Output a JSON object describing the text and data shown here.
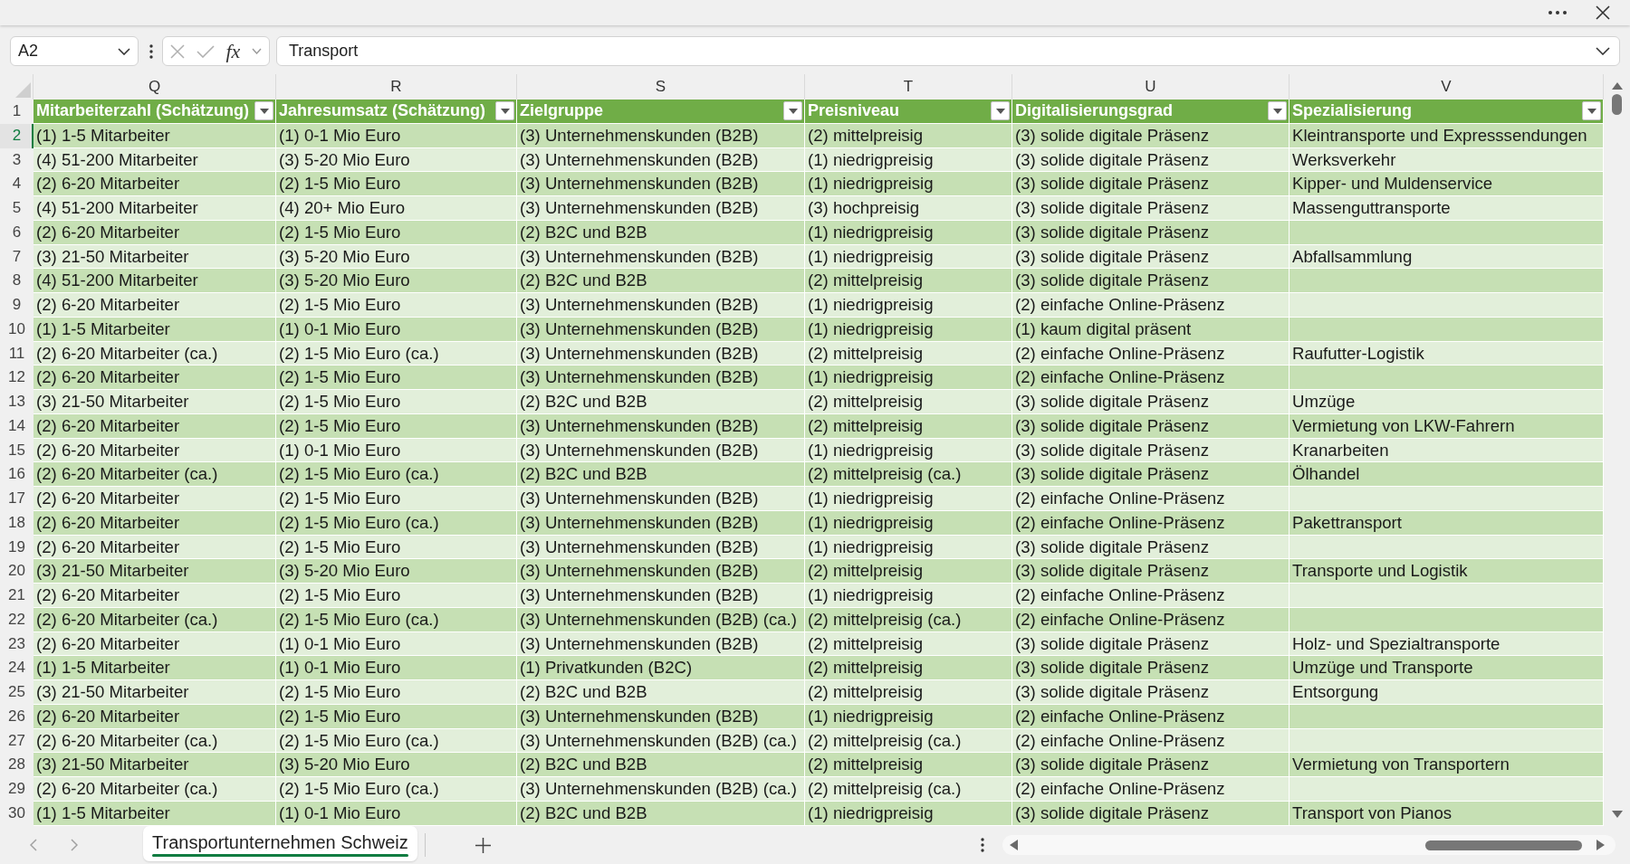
{
  "formula_bar": {
    "name_box": "A2",
    "function_label": "fx",
    "formula": "Transport"
  },
  "columns": [
    {
      "letter": "Q",
      "header": "Mitarbeiterzahl (Schätzung)"
    },
    {
      "letter": "R",
      "header": "Jahresumsatz (Schätzung)"
    },
    {
      "letter": "S",
      "header": "Zielgruppe"
    },
    {
      "letter": "T",
      "header": "Preisniveau"
    },
    {
      "letter": "U",
      "header": "Digitalisierungsgrad"
    },
    {
      "letter": "V",
      "header": "Spezialisierung"
    }
  ],
  "header_row_number": "1",
  "rows": [
    {
      "number": "2",
      "selected": true,
      "mitarbeiterzahl": "(1) 1-5 Mitarbeiter",
      "jahresumsatz": "(1) 0-1 Mio Euro",
      "zielgruppe": "(3) Unternehmenskunden (B2B)",
      "preisniveau": "(2) mittelpreisig",
      "digitalisierungsgrad": "(3) solide digitale Präsenz",
      "spezialisierung": "Kleintransporte und Expresssendungen"
    },
    {
      "number": "3",
      "selected": false,
      "mitarbeiterzahl": "(4) 51-200 Mitarbeiter",
      "jahresumsatz": "(3) 5-20 Mio Euro",
      "zielgruppe": "(3) Unternehmenskunden (B2B)",
      "preisniveau": "(1) niedrigpreisig",
      "digitalisierungsgrad": "(3) solide digitale Präsenz",
      "spezialisierung": "Werksverkehr"
    },
    {
      "number": "4",
      "selected": false,
      "mitarbeiterzahl": "(2) 6-20 Mitarbeiter",
      "jahresumsatz": "(2) 1-5 Mio Euro",
      "zielgruppe": "(3) Unternehmenskunden (B2B)",
      "preisniveau": "(1) niedrigpreisig",
      "digitalisierungsgrad": "(3) solide digitale Präsenz",
      "spezialisierung": "Kipper- und Muldenservice"
    },
    {
      "number": "5",
      "selected": false,
      "mitarbeiterzahl": "(4) 51-200 Mitarbeiter",
      "jahresumsatz": "(4) 20+ Mio Euro",
      "zielgruppe": "(3) Unternehmenskunden (B2B)",
      "preisniveau": "(3) hochpreisig",
      "digitalisierungsgrad": "(3) solide digitale Präsenz",
      "spezialisierung": "Massenguttransporte"
    },
    {
      "number": "6",
      "selected": false,
      "mitarbeiterzahl": "(2) 6-20 Mitarbeiter",
      "jahresumsatz": "(2) 1-5 Mio Euro",
      "zielgruppe": "(2) B2C und B2B",
      "preisniveau": "(1) niedrigpreisig",
      "digitalisierungsgrad": "(3) solide digitale Präsenz"
    },
    {
      "number": "7",
      "selected": false,
      "mitarbeiterzahl": "(3) 21-50 Mitarbeiter",
      "jahresumsatz": "(3) 5-20 Mio Euro",
      "zielgruppe": "(3) Unternehmenskunden (B2B)",
      "preisniveau": "(1) niedrigpreisig",
      "digitalisierungsgrad": "(3) solide digitale Präsenz",
      "spezialisierung": "Abfallsammlung"
    },
    {
      "number": "8",
      "selected": false,
      "mitarbeiterzahl": "(4) 51-200 Mitarbeiter",
      "jahresumsatz": "(3) 5-20 Mio Euro",
      "zielgruppe": "(2) B2C und B2B",
      "preisniveau": "(2) mittelpreisig",
      "digitalisierungsgrad": "(3) solide digitale Präsenz"
    },
    {
      "number": "9",
      "selected": false,
      "mitarbeiterzahl": "(2) 6-20 Mitarbeiter",
      "jahresumsatz": "(2) 1-5 Mio Euro",
      "zielgruppe": "(3) Unternehmenskunden (B2B)",
      "preisniveau": "(1) niedrigpreisig",
      "digitalisierungsgrad": "(2) einfache Online-Präsenz"
    },
    {
      "number": "10",
      "selected": false,
      "mitarbeiterzahl": "(1) 1-5 Mitarbeiter",
      "jahresumsatz": "(1) 0-1 Mio Euro",
      "zielgruppe": "(3) Unternehmenskunden (B2B)",
      "preisniveau": "(1) niedrigpreisig",
      "digitalisierungsgrad": "(1) kaum digital präsent"
    },
    {
      "number": "11",
      "selected": false,
      "mitarbeiterzahl": "(2) 6-20 Mitarbeiter (ca.)",
      "jahresumsatz": "(2) 1-5 Mio Euro (ca.)",
      "zielgruppe": "(3) Unternehmenskunden (B2B)",
      "preisniveau": "(2) mittelpreisig",
      "digitalisierungsgrad": "(2) einfache Online-Präsenz",
      "spezialisierung": "Raufutter-Logistik"
    },
    {
      "number": "12",
      "selected": false,
      "mitarbeiterzahl": "(2) 6-20 Mitarbeiter",
      "jahresumsatz": "(2) 1-5 Mio Euro",
      "zielgruppe": "(3) Unternehmenskunden (B2B)",
      "preisniveau": "(1) niedrigpreisig",
      "digitalisierungsgrad": "(2) einfache Online-Präsenz"
    },
    {
      "number": "13",
      "selected": false,
      "mitarbeiterzahl": "(3) 21-50 Mitarbeiter",
      "jahresumsatz": "(2) 1-5 Mio Euro",
      "zielgruppe": "(2) B2C und B2B",
      "preisniveau": "(2) mittelpreisig",
      "digitalisierungsgrad": "(3) solide digitale Präsenz",
      "spezialisierung": "Umzüge"
    },
    {
      "number": "14",
      "selected": false,
      "mitarbeiterzahl": "(2) 6-20 Mitarbeiter",
      "jahresumsatz": "(2) 1-5 Mio Euro",
      "zielgruppe": "(3) Unternehmenskunden (B2B)",
      "preisniveau": "(2) mittelpreisig",
      "digitalisierungsgrad": "(3) solide digitale Präsenz",
      "spezialisierung": "Vermietung von LKW-Fahrern"
    },
    {
      "number": "15",
      "selected": false,
      "mitarbeiterzahl": "(2) 6-20 Mitarbeiter",
      "jahresumsatz": "(1) 0-1 Mio Euro",
      "zielgruppe": "(3) Unternehmenskunden (B2B)",
      "preisniveau": "(1) niedrigpreisig",
      "digitalisierungsgrad": "(3) solide digitale Präsenz",
      "spezialisierung": "Kranarbeiten"
    },
    {
      "number": "16",
      "selected": false,
      "mitarbeiterzahl": "(2) 6-20 Mitarbeiter (ca.)",
      "jahresumsatz": "(2) 1-5 Mio Euro (ca.)",
      "zielgruppe": "(2) B2C und B2B",
      "preisniveau": "(2) mittelpreisig (ca.)",
      "digitalisierungsgrad": "(3) solide digitale Präsenz",
      "spezialisierung": "Ölhandel"
    },
    {
      "number": "17",
      "selected": false,
      "mitarbeiterzahl": "(2) 6-20 Mitarbeiter",
      "jahresumsatz": "(2) 1-5 Mio Euro",
      "zielgruppe": "(3) Unternehmenskunden (B2B)",
      "preisniveau": "(1) niedrigpreisig",
      "digitalisierungsgrad": "(2) einfache Online-Präsenz"
    },
    {
      "number": "18",
      "selected": false,
      "mitarbeiterzahl": "(2) 6-20 Mitarbeiter",
      "jahresumsatz": "(2) 1-5 Mio Euro (ca.)",
      "zielgruppe": "(3) Unternehmenskunden (B2B)",
      "preisniveau": "(1) niedrigpreisig",
      "digitalisierungsgrad": "(2) einfache Online-Präsenz",
      "spezialisierung": "Pakettransport"
    },
    {
      "number": "19",
      "selected": false,
      "mitarbeiterzahl": "(2) 6-20 Mitarbeiter",
      "jahresumsatz": "(2) 1-5 Mio Euro",
      "zielgruppe": "(3) Unternehmenskunden (B2B)",
      "preisniveau": "(1) niedrigpreisig",
      "digitalisierungsgrad": "(3) solide digitale Präsenz"
    },
    {
      "number": "20",
      "selected": false,
      "mitarbeiterzahl": "(3) 21-50 Mitarbeiter",
      "jahresumsatz": "(3) 5-20 Mio Euro",
      "zielgruppe": "(3) Unternehmenskunden (B2B)",
      "preisniveau": "(2) mittelpreisig",
      "digitalisierungsgrad": "(3) solide digitale Präsenz",
      "spezialisierung": "Transporte und Logistik"
    },
    {
      "number": "21",
      "selected": false,
      "mitarbeiterzahl": "(2) 6-20 Mitarbeiter",
      "jahresumsatz": "(2) 1-5 Mio Euro",
      "zielgruppe": "(3) Unternehmenskunden (B2B)",
      "preisniveau": "(1) niedrigpreisig",
      "digitalisierungsgrad": "(2) einfache Online-Präsenz"
    },
    {
      "number": "22",
      "selected": false,
      "mitarbeiterzahl": "(2) 6-20 Mitarbeiter (ca.)",
      "jahresumsatz": "(2) 1-5 Mio Euro (ca.)",
      "zielgruppe": "(3) Unternehmenskunden (B2B) (ca.)",
      "preisniveau": "(2) mittelpreisig (ca.)",
      "digitalisierungsgrad": "(2) einfache Online-Präsenz"
    },
    {
      "number": "23",
      "selected": false,
      "mitarbeiterzahl": "(2) 6-20 Mitarbeiter",
      "jahresumsatz": "(1) 0-1 Mio Euro",
      "zielgruppe": "(3) Unternehmenskunden (B2B)",
      "preisniveau": "(2) mittelpreisig",
      "digitalisierungsgrad": "(3) solide digitale Präsenz",
      "spezialisierung": "Holz- und Spezialtransporte"
    },
    {
      "number": "24",
      "selected": false,
      "mitarbeiterzahl": "(1) 1-5 Mitarbeiter",
      "jahresumsatz": "(1) 0-1 Mio Euro",
      "zielgruppe": "(1) Privatkunden (B2C)",
      "preisniveau": "(2) mittelpreisig",
      "digitalisierungsgrad": "(3) solide digitale Präsenz",
      "spezialisierung": "Umzüge und Transporte"
    },
    {
      "number": "25",
      "selected": false,
      "mitarbeiterzahl": "(3) 21-50 Mitarbeiter",
      "jahresumsatz": "(2) 1-5 Mio Euro",
      "zielgruppe": "(2) B2C und B2B",
      "preisniveau": "(2) mittelpreisig",
      "digitalisierungsgrad": "(3) solide digitale Präsenz",
      "spezialisierung": "Entsorgung"
    },
    {
      "number": "26",
      "selected": false,
      "mitarbeiterzahl": "(2) 6-20 Mitarbeiter",
      "jahresumsatz": "(2) 1-5 Mio Euro",
      "zielgruppe": "(3) Unternehmenskunden (B2B)",
      "preisniveau": "(1) niedrigpreisig",
      "digitalisierungsgrad": "(2) einfache Online-Präsenz"
    },
    {
      "number": "27",
      "selected": false,
      "mitarbeiterzahl": "(2) 6-20 Mitarbeiter (ca.)",
      "jahresumsatz": "(2) 1-5 Mio Euro (ca.)",
      "zielgruppe": "(3) Unternehmenskunden (B2B) (ca.)",
      "preisniveau": "(2) mittelpreisig (ca.)",
      "digitalisierungsgrad": "(2) einfache Online-Präsenz"
    },
    {
      "number": "28",
      "selected": false,
      "mitarbeiterzahl": "(3) 21-50 Mitarbeiter",
      "jahresumsatz": "(3) 5-20 Mio Euro",
      "zielgruppe": "(2) B2C und B2B",
      "preisniveau": "(2) mittelpreisig",
      "digitalisierungsgrad": "(3) solide digitale Präsenz",
      "spezialisierung": "Vermietung von Transportern"
    },
    {
      "number": "29",
      "selected": false,
      "mitarbeiterzahl": "(2) 6-20 Mitarbeiter (ca.)",
      "jahresumsatz": "(2) 1-5 Mio Euro (ca.)",
      "zielgruppe": "(3) Unternehmenskunden (B2B) (ca.)",
      "preisniveau": "(2) mittelpreisig (ca.)",
      "digitalisierungsgrad": "(2) einfache Online-Präsenz"
    },
    {
      "number": "30",
      "selected": false,
      "mitarbeiterzahl": "(1) 1-5 Mitarbeiter",
      "jahresumsatz": "(1) 0-1 Mio Euro",
      "zielgruppe": "(2) B2C und B2B",
      "preisniveau": "(1) niedrigpreisig",
      "digitalisierungsgrad": "(3) solide digitale Präsenz",
      "spezialisierung": "Transport von Pianos"
    }
  ],
  "sheet_tabs": [
    {
      "label": "Transportunternehmen Schweiz",
      "selected": true
    }
  ]
}
